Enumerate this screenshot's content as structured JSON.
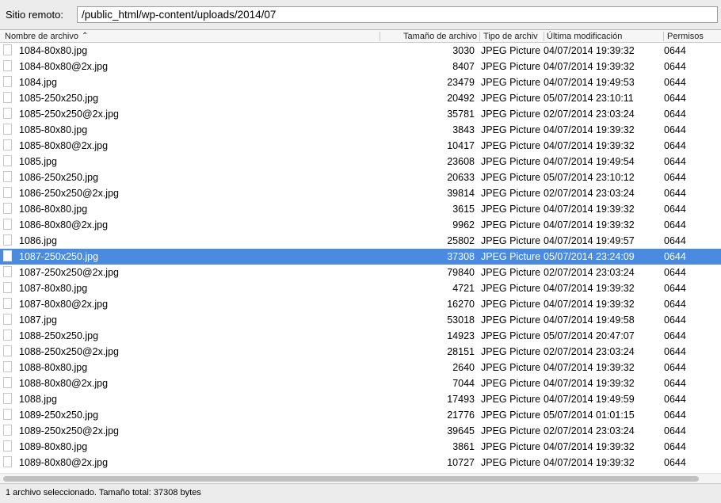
{
  "remote": {
    "label": "Sitio remoto:",
    "path": "/public_html/wp-content/uploads/2014/07"
  },
  "columns": {
    "name": "Nombre de archivo",
    "size": "Tamaño de archivo",
    "type": "Tipo de archiv",
    "modified": "Última modificación",
    "perms": "Permisos"
  },
  "sort": {
    "column": "name",
    "direction": "ascending",
    "icon": "chevron-up-icon"
  },
  "files": [
    {
      "name": "1084-80x80.jpg",
      "size": "3030",
      "type": "JPEG Picture",
      "modified": "04/07/2014 19:39:32",
      "perms": "0644"
    },
    {
      "name": "1084-80x80@2x.jpg",
      "size": "8407",
      "type": "JPEG Picture",
      "modified": "04/07/2014 19:39:32",
      "perms": "0644"
    },
    {
      "name": "1084.jpg",
      "size": "23479",
      "type": "JPEG Picture",
      "modified": "04/07/2014 19:49:53",
      "perms": "0644"
    },
    {
      "name": "1085-250x250.jpg",
      "size": "20492",
      "type": "JPEG Picture",
      "modified": "05/07/2014 23:10:11",
      "perms": "0644"
    },
    {
      "name": "1085-250x250@2x.jpg",
      "size": "35781",
      "type": "JPEG Picture",
      "modified": "02/07/2014 23:03:24",
      "perms": "0644"
    },
    {
      "name": "1085-80x80.jpg",
      "size": "3843",
      "type": "JPEG Picture",
      "modified": "04/07/2014 19:39:32",
      "perms": "0644"
    },
    {
      "name": "1085-80x80@2x.jpg",
      "size": "10417",
      "type": "JPEG Picture",
      "modified": "04/07/2014 19:39:32",
      "perms": "0644"
    },
    {
      "name": "1085.jpg",
      "size": "23608",
      "type": "JPEG Picture",
      "modified": "04/07/2014 19:49:54",
      "perms": "0644"
    },
    {
      "name": "1086-250x250.jpg",
      "size": "20633",
      "type": "JPEG Picture",
      "modified": "05/07/2014 23:10:12",
      "perms": "0644"
    },
    {
      "name": "1086-250x250@2x.jpg",
      "size": "39814",
      "type": "JPEG Picture",
      "modified": "02/07/2014 23:03:24",
      "perms": "0644"
    },
    {
      "name": "1086-80x80.jpg",
      "size": "3615",
      "type": "JPEG Picture",
      "modified": "04/07/2014 19:39:32",
      "perms": "0644"
    },
    {
      "name": "1086-80x80@2x.jpg",
      "size": "9962",
      "type": "JPEG Picture",
      "modified": "04/07/2014 19:39:32",
      "perms": "0644"
    },
    {
      "name": "1086.jpg",
      "size": "25802",
      "type": "JPEG Picture",
      "modified": "04/07/2014 19:49:57",
      "perms": "0644"
    },
    {
      "name": "1087-250x250.jpg",
      "size": "37308",
      "type": "JPEG Picture",
      "modified": "05/07/2014 23:24:09",
      "perms": "0644",
      "selected": true
    },
    {
      "name": "1087-250x250@2x.jpg",
      "size": "79840",
      "type": "JPEG Picture",
      "modified": "02/07/2014 23:03:24",
      "perms": "0644"
    },
    {
      "name": "1087-80x80.jpg",
      "size": "4721",
      "type": "JPEG Picture",
      "modified": "04/07/2014 19:39:32",
      "perms": "0644"
    },
    {
      "name": "1087-80x80@2x.jpg",
      "size": "16270",
      "type": "JPEG Picture",
      "modified": "04/07/2014 19:39:32",
      "perms": "0644"
    },
    {
      "name": "1087.jpg",
      "size": "53018",
      "type": "JPEG Picture",
      "modified": "04/07/2014 19:49:58",
      "perms": "0644"
    },
    {
      "name": "1088-250x250.jpg",
      "size": "14923",
      "type": "JPEG Picture",
      "modified": "05/07/2014 20:47:07",
      "perms": "0644"
    },
    {
      "name": "1088-250x250@2x.jpg",
      "size": "28151",
      "type": "JPEG Picture",
      "modified": "02/07/2014 23:03:24",
      "perms": "0644"
    },
    {
      "name": "1088-80x80.jpg",
      "size": "2640",
      "type": "JPEG Picture",
      "modified": "04/07/2014 19:39:32",
      "perms": "0644"
    },
    {
      "name": "1088-80x80@2x.jpg",
      "size": "7044",
      "type": "JPEG Picture",
      "modified": "04/07/2014 19:39:32",
      "perms": "0644"
    },
    {
      "name": "1088.jpg",
      "size": "17493",
      "type": "JPEG Picture",
      "modified": "04/07/2014 19:49:59",
      "perms": "0644"
    },
    {
      "name": "1089-250x250.jpg",
      "size": "21776",
      "type": "JPEG Picture",
      "modified": "05/07/2014 01:01:15",
      "perms": "0644"
    },
    {
      "name": "1089-250x250@2x.jpg",
      "size": "39645",
      "type": "JPEG Picture",
      "modified": "02/07/2014 23:03:24",
      "perms": "0644"
    },
    {
      "name": "1089-80x80.jpg",
      "size": "3861",
      "type": "JPEG Picture",
      "modified": "04/07/2014 19:39:32",
      "perms": "0644"
    },
    {
      "name": "1089-80x80@2x.jpg",
      "size": "10727",
      "type": "JPEG Picture",
      "modified": "04/07/2014 19:39:32",
      "perms": "0644"
    }
  ],
  "file_icon": "file-icon",
  "status": "1 archivo seleccionado. Tamaño total: 37308 bytes",
  "colors": {
    "selection": "#4a8be0",
    "background": "#ececec"
  }
}
